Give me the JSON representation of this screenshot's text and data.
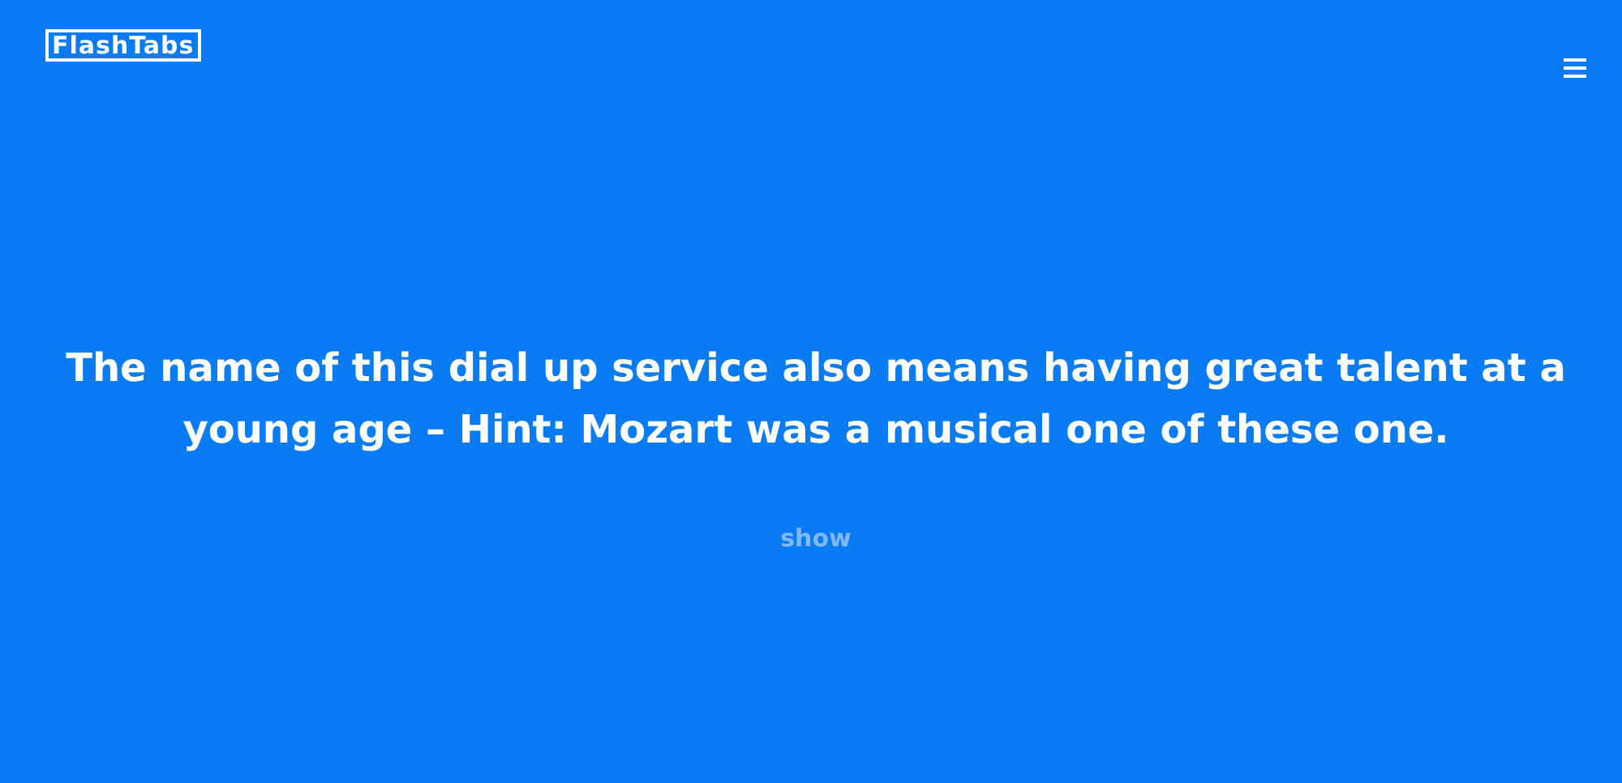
{
  "header": {
    "logo": "FlashTabs"
  },
  "card": {
    "question": "The name of this dial up service also means having great talent at a young age – Hint: Mozart was a musical one of these one.",
    "reveal_link": "show"
  }
}
